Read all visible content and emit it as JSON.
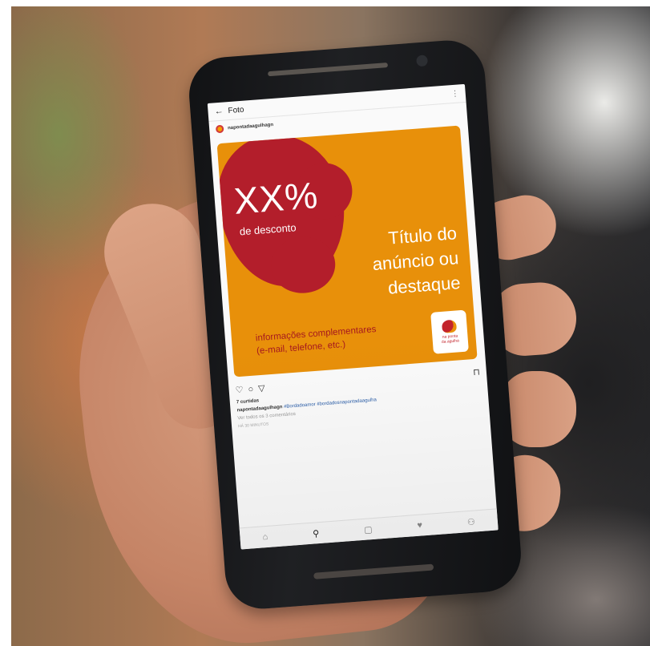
{
  "colors": {
    "ad_orange": "#e8900a",
    "ad_red": "#b31e2b",
    "link_blue": "#2b5ea8"
  },
  "app": {
    "title": "Foto",
    "username": "napontadaagulhagn"
  },
  "ad": {
    "discount": "XX%",
    "discount_sub": "de desconto",
    "headline_1": "Título do",
    "headline_2": "anúncio ou",
    "headline_3": "destaque",
    "info_1": "informações complementares",
    "info_2": "(e-mail, telefone, etc.)",
    "logo_1": "na ponta",
    "logo_2": "da agulha"
  },
  "post": {
    "likes": "7 curtidas",
    "caption_user": "napontadaagulhagn",
    "caption_tags": "#Bordadoamor #bordadosnapontadaagulha",
    "comments": "Ver todos os 3 comentários",
    "time": "HÁ 30 MINUTOS"
  },
  "icons": {
    "back": "←",
    "more": "⋮",
    "like": "♡",
    "comment": "○",
    "share": "▽",
    "bookmark": "⊓",
    "home": "⌂",
    "search": "⚲",
    "camera": "▢",
    "activity": "♥",
    "profile": "⚇"
  }
}
